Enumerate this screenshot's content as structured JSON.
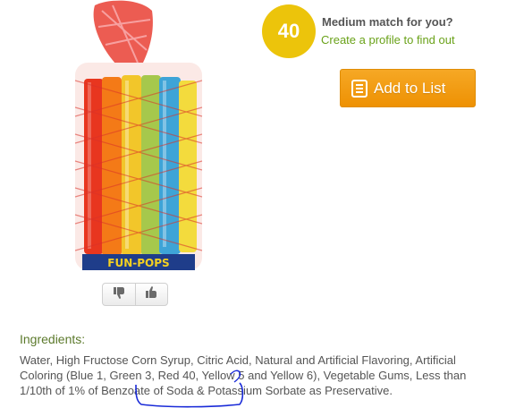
{
  "score": {
    "value": "40",
    "title": "Medium match for you?",
    "profile_link": "Create a profile to find out"
  },
  "actions": {
    "add_to_list_label": "Add to List",
    "add_to_list_icon": "list-icon"
  },
  "product_image": {
    "label": "FUN-POPS",
    "bar_colors": [
      "#e8361f",
      "#f47a17",
      "#f2c62a",
      "#a6c84c",
      "#3ea4d7",
      "#f3db3d"
    ],
    "net_color": "#e32a2a"
  },
  "rating": {
    "thumbs_down_icon": "thumbs-down-icon",
    "thumbs_up_icon": "thumbs-up-icon"
  },
  "ingredients": {
    "heading": "Ingredients:",
    "text": "Water, High Fructose Corn Syrup, Citric Acid, Natural and Artificial Flavoring, Artificial Coloring (Blue 1, Green 3, Red 40, Yellow 5 and Yellow 6), Vegetable Gums, Less than 1/10th of 1% of Benzoate of Soda & Potassium Sorbate as Preservative."
  },
  "colors": {
    "badge": "#ecc40b",
    "link": "#6aa219",
    "button": "#f29a0f",
    "heading": "#5c7a2c",
    "annotation": "#1a2bd8"
  }
}
